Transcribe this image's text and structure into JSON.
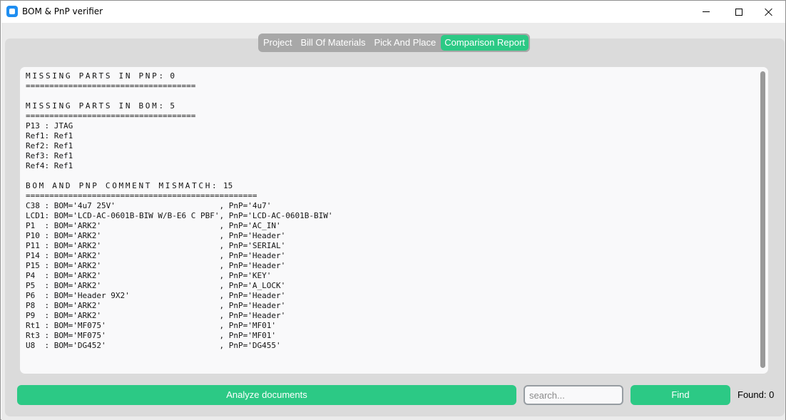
{
  "window": {
    "title": "BOM & PnP verifier",
    "icon": "app-icon",
    "controls": [
      "minimize-icon",
      "maximize-icon",
      "close-icon"
    ]
  },
  "tabs": [
    {
      "label": "Project",
      "active": false
    },
    {
      "label": "Bill Of Materials",
      "active": false
    },
    {
      "label": "Pick And Place",
      "active": false
    },
    {
      "label": "Comparison Report",
      "active": true
    }
  ],
  "report": {
    "missing_pnp": {
      "heading": "MISSING PARTS IN PNP:",
      "count": "0",
      "separator": "====================================",
      "lines": []
    },
    "missing_bom": {
      "heading": "MISSING PARTS IN BOM:",
      "count": "5",
      "separator": "====================================",
      "lines": [
        "P13 : JTAG",
        "Ref1: Ref1",
        "Ref2: Ref1",
        "Ref3: Ref1",
        "Ref4: Ref1"
      ]
    },
    "comment_mismatch": {
      "heading": "BOM AND PNP COMMENT MISMATCH:",
      "count": "15",
      "separator": "=================================================",
      "lines": [
        "C38 : BOM='4u7 25V'                      , PnP='4u7'",
        "LCD1: BOM='LCD-AC-0601B-BIW W/B-E6 C PBF', PnP='LCD-AC-0601B-BIW'",
        "P1  : BOM='ARK2'                         , PnP='AC_IN'",
        "P10 : BOM='ARK2'                         , PnP='Header'",
        "P11 : BOM='ARK2'                         , PnP='SERIAL'",
        "P14 : BOM='ARK2'                         , PnP='Header'",
        "P15 : BOM='ARK2'                         , PnP='Header'",
        "P4  : BOM='ARK2'                         , PnP='KEY'",
        "P5  : BOM='ARK2'                         , PnP='A_LOCK'",
        "P6  : BOM='Header 9X2'                   , PnP='Header'",
        "P8  : BOM='ARK2'                         , PnP='Header'",
        "P9  : BOM='ARK2'                         , PnP='Header'",
        "Rt1 : BOM='MF075'                        , PnP='MF01'",
        "Rt3 : BOM='MF075'                        , PnP='MF01'",
        "U8  : BOM='DG452'                        , PnP='DG455'"
      ]
    }
  },
  "actions": {
    "analyze_label": "Analyze documents",
    "search_placeholder": "search...",
    "search_value": "",
    "find_label": "Find",
    "found_text": "Found: 0"
  },
  "colors": {
    "accent": "#2cc985",
    "tab_inactive": "#a8a8a8",
    "frame": "#dbdbdb",
    "background": "#ebebeb",
    "textbox": "#f9f9fa",
    "scrollbar": "#999999"
  }
}
